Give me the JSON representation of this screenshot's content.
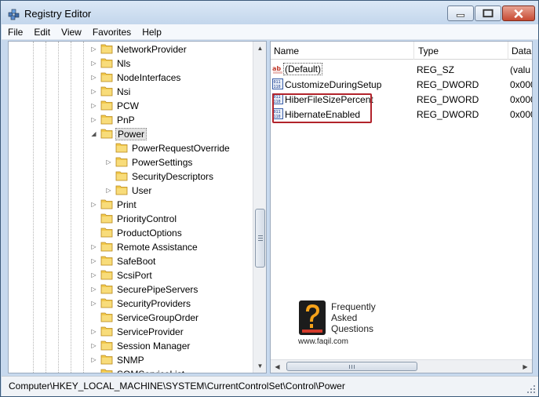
{
  "window": {
    "title": "Registry Editor",
    "icon": "registry-editor-icon"
  },
  "menu": [
    "File",
    "Edit",
    "View",
    "Favorites",
    "Help"
  ],
  "tree": {
    "items": [
      {
        "label": "NetworkProvider",
        "level": 0,
        "expander": "collapsed"
      },
      {
        "label": "Nls",
        "level": 0,
        "expander": "collapsed"
      },
      {
        "label": "NodeInterfaces",
        "level": 0,
        "expander": "collapsed"
      },
      {
        "label": "Nsi",
        "level": 0,
        "expander": "collapsed"
      },
      {
        "label": "PCW",
        "level": 0,
        "expander": "collapsed"
      },
      {
        "label": "PnP",
        "level": 0,
        "expander": "collapsed"
      },
      {
        "label": "Power",
        "level": 0,
        "expander": "expanded",
        "selected": true
      },
      {
        "label": "PowerRequestOverride",
        "level": 1,
        "expander": "none"
      },
      {
        "label": "PowerSettings",
        "level": 1,
        "expander": "collapsed"
      },
      {
        "label": "SecurityDescriptors",
        "level": 1,
        "expander": "none"
      },
      {
        "label": "User",
        "level": 1,
        "expander": "collapsed"
      },
      {
        "label": "Print",
        "level": 0,
        "expander": "collapsed"
      },
      {
        "label": "PriorityControl",
        "level": 0,
        "expander": "none"
      },
      {
        "label": "ProductOptions",
        "level": 0,
        "expander": "none"
      },
      {
        "label": "Remote Assistance",
        "level": 0,
        "expander": "collapsed"
      },
      {
        "label": "SafeBoot",
        "level": 0,
        "expander": "collapsed"
      },
      {
        "label": "ScsiPort",
        "level": 0,
        "expander": "collapsed"
      },
      {
        "label": "SecurePipeServers",
        "level": 0,
        "expander": "collapsed"
      },
      {
        "label": "SecurityProviders",
        "level": 0,
        "expander": "collapsed"
      },
      {
        "label": "ServiceGroupOrder",
        "level": 0,
        "expander": "none"
      },
      {
        "label": "ServiceProvider",
        "level": 0,
        "expander": "collapsed"
      },
      {
        "label": "Session Manager",
        "level": 0,
        "expander": "collapsed"
      },
      {
        "label": "SNMP",
        "level": 0,
        "expander": "collapsed"
      },
      {
        "label": "SQMServiceList",
        "level": 0,
        "expander": "none"
      }
    ]
  },
  "list": {
    "columns": [
      "Name",
      "Type",
      "Data"
    ],
    "rows": [
      {
        "name": "(Default)",
        "type": "REG_SZ",
        "data": "(valu",
        "icon": "string-value-icon"
      },
      {
        "name": "CustomizeDuringSetup",
        "type": "REG_DWORD",
        "data": "0x000",
        "icon": "dword-value-icon"
      },
      {
        "name": "HiberFileSizePercent",
        "type": "REG_DWORD",
        "data": "0x000",
        "icon": "dword-value-icon"
      },
      {
        "name": "HibernateEnabled",
        "type": "REG_DWORD",
        "data": "0x000",
        "icon": "dword-value-icon"
      }
    ]
  },
  "logo": {
    "line1": "Frequently",
    "line2": "Asked",
    "line3": "Questions",
    "url": "www.faqil.com"
  },
  "status": {
    "path": "Computer\\HKEY_LOCAL_MACHINE\\SYSTEM\\CurrentControlSet\\Control\\Power"
  },
  "colors": {
    "folder": "#f2c94c",
    "highlight": "#b2232b",
    "selection": "#e2e2e2"
  }
}
